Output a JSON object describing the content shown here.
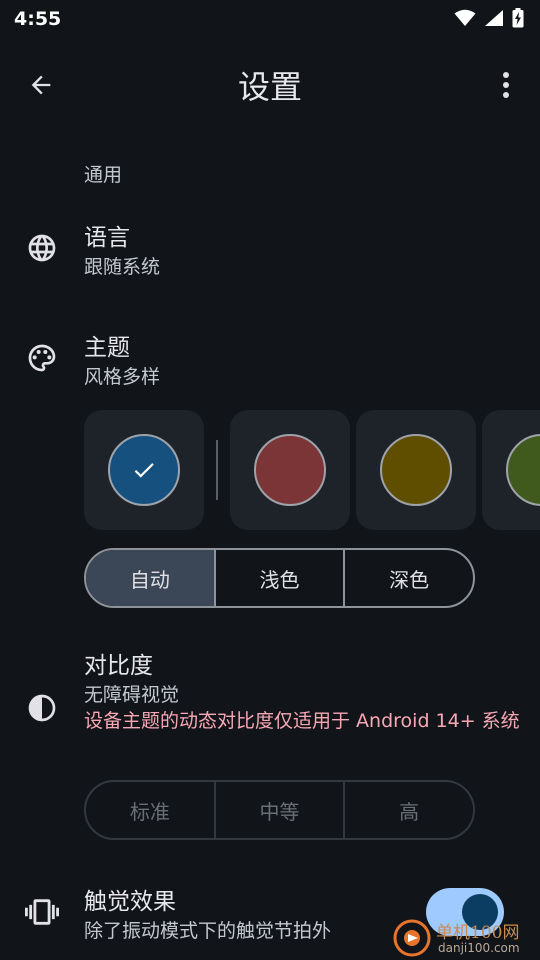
{
  "status_bar": {
    "time": "4:55"
  },
  "app_bar": {
    "title": "设置"
  },
  "sections": {
    "general": "通用"
  },
  "language": {
    "title": "语言",
    "subtitle": "跟随系统"
  },
  "theme": {
    "title": "主题",
    "subtitle": "风格多样",
    "swatches": [
      {
        "color": "#15507f",
        "selected": true
      },
      {
        "color": "#7b3536",
        "selected": false
      },
      {
        "color": "#5f4e00",
        "selected": false
      },
      {
        "color": "#3f5a1c",
        "selected": false
      }
    ],
    "modes": [
      "自动",
      "浅色",
      "深色"
    ],
    "selected_mode": "自动"
  },
  "contrast": {
    "title": "对比度",
    "subtitle": "无障碍视觉",
    "warning": "设备主题的动态对比度仅适用于 Android 14+ 系统",
    "levels": [
      "标准",
      "中等",
      "高"
    ]
  },
  "haptics": {
    "title": "触觉效果",
    "subtitle": "除了振动模式下的触觉节拍外",
    "enabled": true
  },
  "watermark": {
    "name": "单机100网",
    "url": "danji100.com"
  },
  "colors": {
    "background": "#111418",
    "accent": "#9ecaff",
    "warning": "#f7a8b4"
  }
}
